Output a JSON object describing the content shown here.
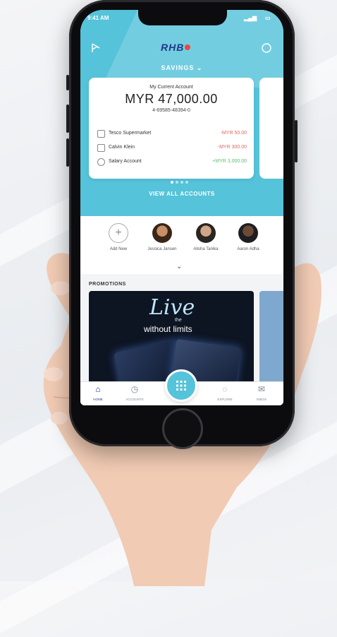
{
  "status_bar": {
    "time": "9:41 AM",
    "signal": "▂▄▆",
    "battery": "▭"
  },
  "header": {
    "logo": "RHB",
    "tab_label": "SAVINGS"
  },
  "account_card": {
    "account_type": "My Current Account",
    "balance": "MYR 47,000.00",
    "account_number": "4-69585-48394-0",
    "transactions": [
      {
        "name": "Tesco Supermarket",
        "amount": "-MYR 50.00",
        "color": "#e0685f"
      },
      {
        "name": "Calvin Klein",
        "amount": "-MYR 300.00",
        "color": "#e0685f"
      },
      {
        "name": "Salary Account",
        "amount": "+MYR 3,000.00",
        "color": "#5bbf6a"
      }
    ]
  },
  "view_all_label": "VIEW ALL ACCOUNTS",
  "favourites": [
    {
      "label": "Add New"
    },
    {
      "label": "Jessica Jansen"
    },
    {
      "label": "Alisha Tanika"
    },
    {
      "label": "Aaron Adha"
    }
  ],
  "promotions": {
    "title": "PROMOTIONS",
    "headline": "Live",
    "small": "the",
    "sub": "without limits"
  },
  "bottom_nav": [
    {
      "label": "HOME"
    },
    {
      "label": "ACCOUNTS"
    },
    {
      "label": "EXPLORE"
    },
    {
      "label": "INBOX"
    }
  ],
  "colors": {
    "brand_teal": "#55c3d9",
    "logo_blue": "#1d3a8a",
    "logo_dot": "#e8483f"
  }
}
